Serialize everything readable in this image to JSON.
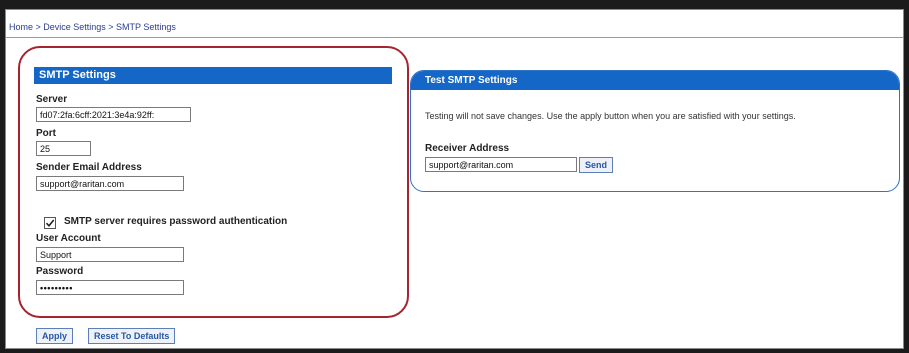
{
  "breadcrumb": "Home > Device Settings > SMTP Settings",
  "smtp_settings": {
    "title": "SMTP Settings",
    "server": {
      "label": "Server",
      "value": "fd07:2fa:6cff:2021:3e4a:92ff:"
    },
    "port": {
      "label": "Port",
      "value": "25"
    },
    "sender": {
      "label": "Sender Email Address",
      "value": "support@raritan.com"
    },
    "auth": {
      "label": "SMTP server requires password authentication",
      "checked": true
    },
    "user": {
      "label": "User Account",
      "value": "Support"
    },
    "password": {
      "label": "Password",
      "value": "•••••••••"
    }
  },
  "test_settings": {
    "title": "Test SMTP Settings",
    "description": "Testing will not save changes. Use the apply button when you are satisfied with your settings.",
    "receiver": {
      "label": "Receiver Address",
      "value": "support@raritan.com"
    },
    "send_label": "Send"
  },
  "actions": {
    "apply_label": "Apply",
    "reset_label": "Reset To Defaults"
  },
  "colors": {
    "header_blue": "#1467c6",
    "highlight_red": "#a6242f"
  }
}
